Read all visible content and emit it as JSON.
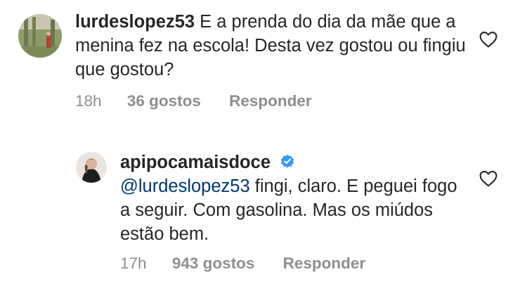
{
  "comments": [
    {
      "username": "lurdeslopez53",
      "text": "E a prenda do dia da mãe que a menina fez na escola! Desta vez gostou ou fingiu que gostou?",
      "time": "18h",
      "likes": "36 gostos",
      "reply_label": "Responder",
      "like_icon": "heart-outline-icon"
    },
    {
      "username": "apipocamaisdoce",
      "verified": true,
      "verified_icon": "verified-badge-icon",
      "mention": "@lurdeslopez53",
      "text": "fingi, claro. E peguei fogo a seguir. Com gasolina. Mas os miúdos estão bem.",
      "time": "17h",
      "likes": "943 gostos",
      "reply_label": "Responder",
      "like_icon": "heart-outline-icon"
    }
  ],
  "colors": {
    "text": "#262626",
    "meta": "#8e8e8e",
    "mention": "#00376b",
    "verified": "#3897f0"
  }
}
